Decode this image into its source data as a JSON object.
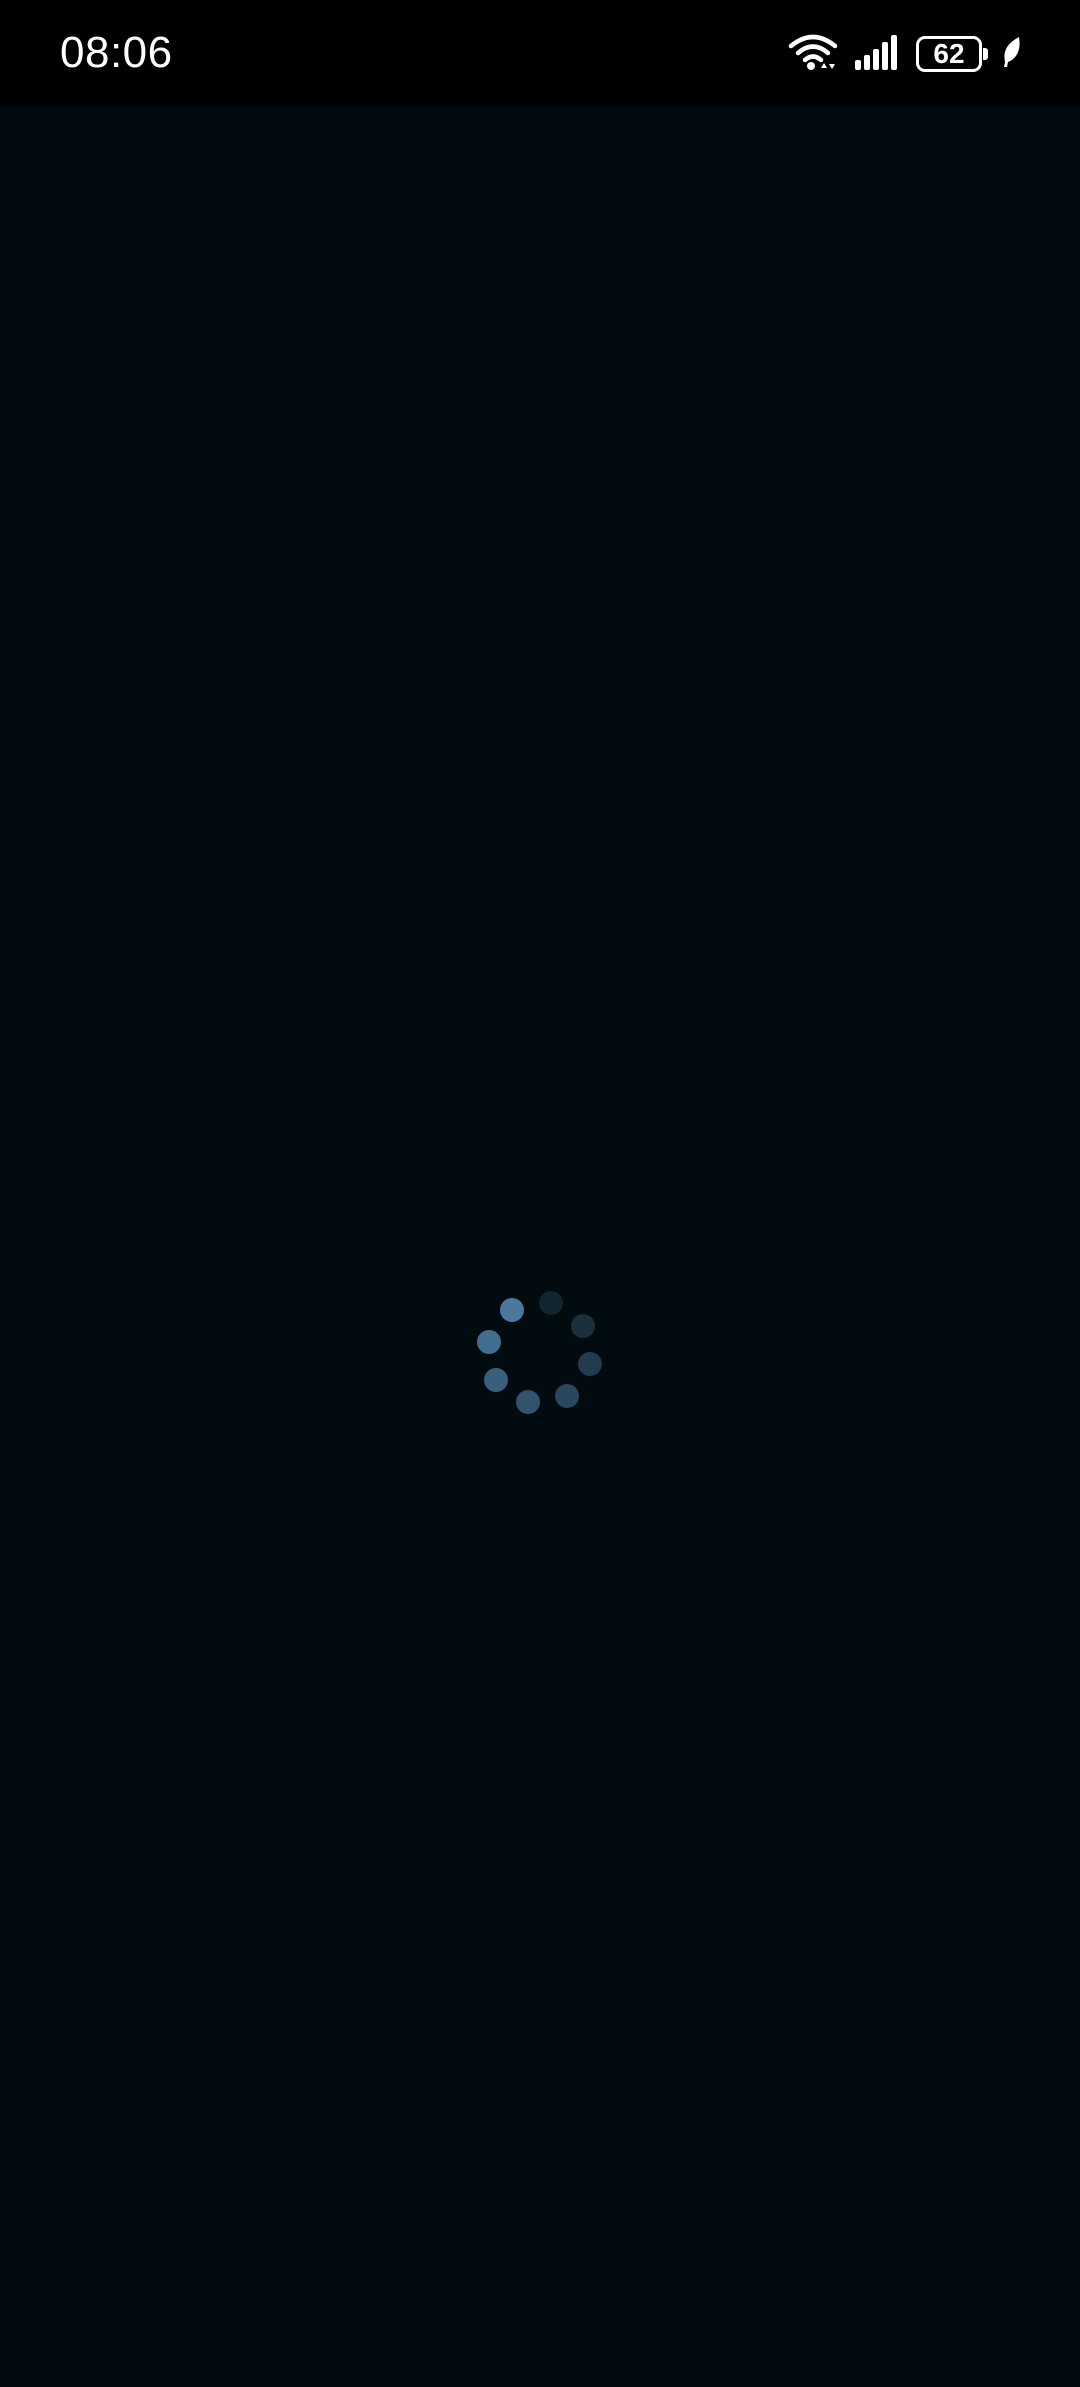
{
  "status_bar": {
    "time": "08:06",
    "battery_level": "62",
    "icons": [
      "wifi-icon",
      "cellular-signal-icon",
      "battery-icon",
      "battery-saver-leaf-icon"
    ]
  },
  "screen": {
    "background_color": "#020b0f",
    "loading_indicator": {
      "type": "dot-spinner",
      "dot_count": 8,
      "color": "#4f7fa6"
    }
  }
}
